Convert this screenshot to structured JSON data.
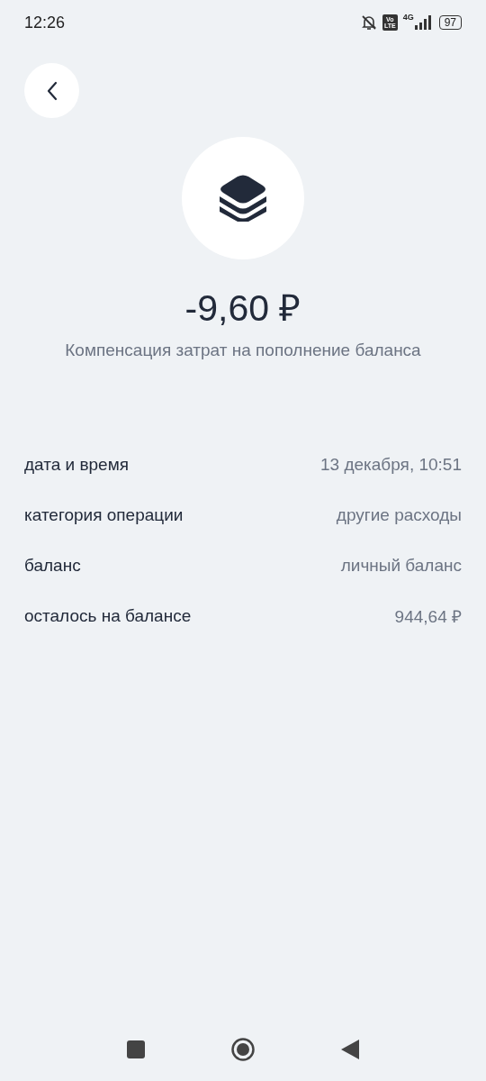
{
  "status_bar": {
    "time": "12:26",
    "volte": "Vo\nLTE",
    "network": "4G",
    "battery": "97"
  },
  "transaction": {
    "amount": "-9,60 ₽",
    "description": "Компенсация затрат на пополнение баланса"
  },
  "details": [
    {
      "label": "дата и время",
      "value": "13 декабря, 10:51"
    },
    {
      "label": "категория операции",
      "value": "другие расходы"
    },
    {
      "label": "баланс",
      "value": "личный баланс"
    },
    {
      "label": "осталось на балансе",
      "value": "944,64 ₽"
    }
  ]
}
